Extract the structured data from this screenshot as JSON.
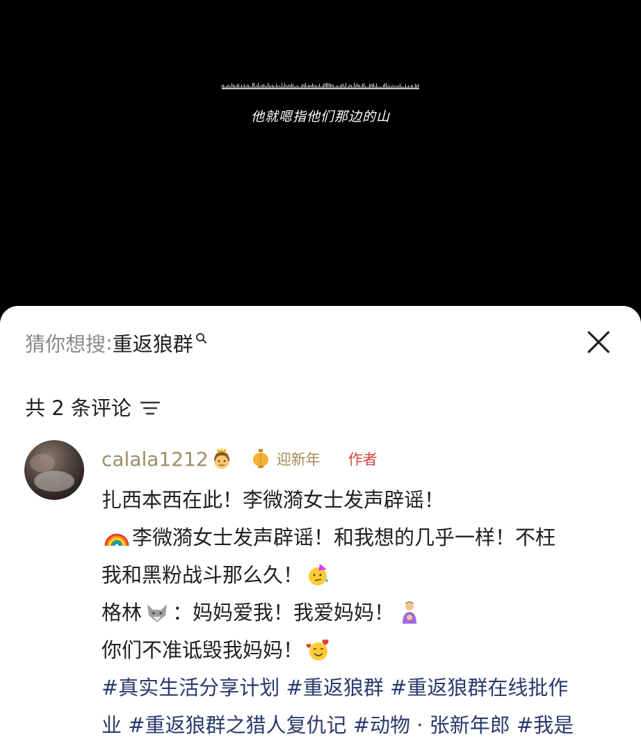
{
  "video": {
    "subtitle": "他就嗯指他们那边的山"
  },
  "sheet": {
    "suggest_label": "猜你想搜",
    "suggest_sep": ":",
    "suggest_term": "重返狼群",
    "comment_count_text": "共 2 条评论"
  },
  "comment": {
    "username": "calala1212",
    "username_emoji": "princess-emoji",
    "badge_text": "迎新年",
    "author_tag": "作者",
    "lines": [
      {
        "text": "扎西本西在此！李微漪女士发声辟谣！"
      },
      {
        "emoji_before": "rainbow-emoji",
        "text": "李微漪女士发声辟谣！和我想的几乎一样！不枉"
      },
      {
        "text": "我和黑粉战斗那么久！",
        "emoji_after": "party-face-emoji"
      },
      {
        "text_a": "格林",
        "inline_emoji": "wolf-emoji",
        "text_b": "：妈妈爱我！我爱妈妈！",
        "emoji_after": "mother-baby-emoji"
      },
      {
        "text": "你们不准诋毁我妈妈！",
        "emoji_after": "smiling-hearts-emoji"
      },
      {
        "text": "#真实生活分享计划 #重返狼群 #重返狼群在线批作"
      },
      {
        "text": "业 #重返狼群之猎人复仇记 #动物 · 张新年郎 #我是"
      }
    ]
  },
  "colors": {
    "username": "#9b8d6a",
    "author_tag": "#d44040",
    "hashtag": "#2a3a6e",
    "suggest_label": "#8a8a8a"
  }
}
